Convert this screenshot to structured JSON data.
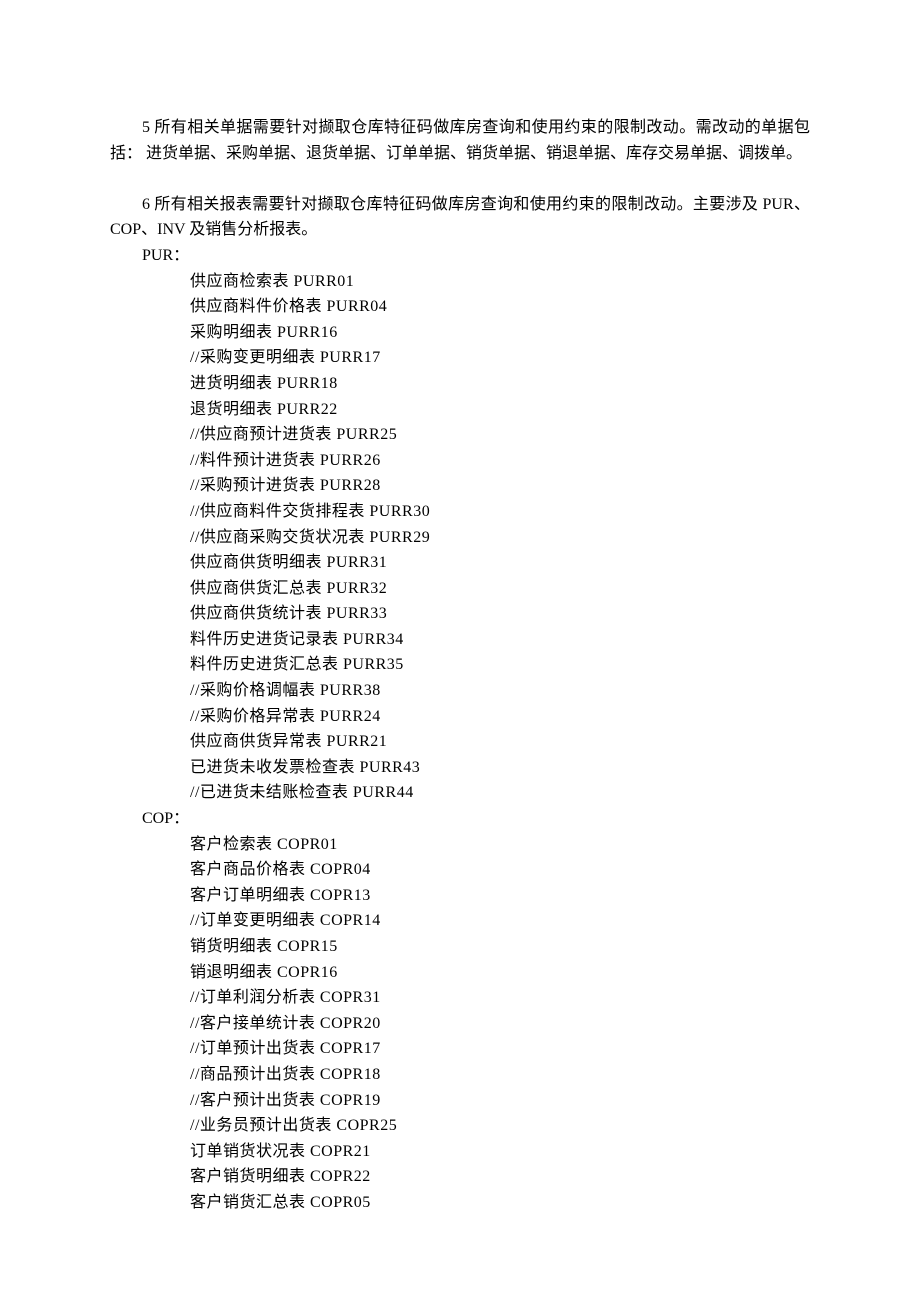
{
  "para5": "5 所有相关单据需要针对撷取仓库特征码做库房查询和使用约束的限制改动。需改动的单据包括： 进货单据、采购单据、退货单据、订单单据、销货单据、销退单据、库存交易单据、调拨单。",
  "para6": "6 所有相关报表需要针对撷取仓库特征码做库房查询和使用约束的限制改动。主要涉及 PUR、COP、INV 及销售分析报表。",
  "pur_label": "PUR：",
  "pur_items": [
    "供应商检索表 PURR01",
    "供应商料件价格表  PURR04",
    "采购明细表 PURR16",
    "//采购变更明细表  PURR17",
    "进货明细表 PURR18",
    "退货明细表 PURR22",
    "//供应商预计进货表  PURR25",
    "//料件预计进货表  PURR26",
    "//采购预计进货表  PURR28",
    "//供应商料件交货排程表   PURR30",
    "//供应商采购交货状况表   PURR29",
    "供应商供货明细表  PURR31",
    "供应商供货汇总表  PURR32",
    "供应商供货统计表  PURR33",
    "料件历史进货记录表  PURR34",
    "料件历史进货汇总表  PURR35",
    "//采购价格调幅表  PURR38",
    "//采购价格异常表  PURR24",
    "供应商供货异常表  PURR21",
    "已进货未收发票检查表   PURR43",
    "//已进货未结账检查表   PURR44"
  ],
  "cop_label": "COP：",
  "cop_items": [
    "客户检索表 COPR01",
    "客户商品价格表  COPR04",
    "客户订单明细表  COPR13",
    "//订单变更明细表  COPR14",
    "销货明细表 COPR15",
    "销退明细表 COPR16",
    "//订单利润分析表  COPR31",
    "//客户接单统计表  COPR20",
    "//订单预计出货表  COPR17",
    "//商品预计出货表  COPR18",
    "//客户预计出货表  COPR19",
    "//业务员预计出货表  COPR25",
    "订单销货状况表  COPR21",
    "客户销货明细表  COPR22",
    "客户销货汇总表  COPR05"
  ]
}
